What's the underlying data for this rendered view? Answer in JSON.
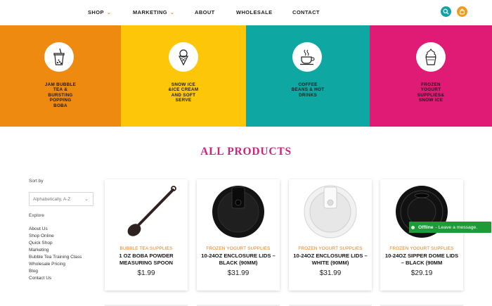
{
  "nav": {
    "shop": "SHOP",
    "marketing": "MARKETING",
    "about": "ABOUT",
    "wholesale": "WHOLESALE",
    "contact": "CONTACT"
  },
  "header_icons": {
    "search": "search-icon",
    "cart": "shopping-bag-icon"
  },
  "colors": {
    "orange": "#ef8a10",
    "yellow": "#fdc608",
    "teal": "#0fa7a1",
    "pink": "#df1b75",
    "title_pink": "#c8267a",
    "chat_green": "#1e9b37"
  },
  "categories": [
    {
      "label": "JAM BUBBLE\nTEA &\nBURSTING\nPOPPING\nBOBA",
      "icon": "bubble-tea-cup-icon"
    },
    {
      "label": "SNOW ICE\n&ICE CREAM\nAND SOFT\nSERVE",
      "icon": "ice-cream-cone-icon"
    },
    {
      "label": "COFFEE\nBEANS & HOT\nDRINKS",
      "icon": "coffee-cup-icon"
    },
    {
      "label": "FROZEN\nYOGURT\nSUPPLIES&\nSNOW ICE",
      "icon": "frozen-yogurt-cup-icon"
    }
  ],
  "page_title": "ALL PRODUCTS",
  "sidebar": {
    "sort_label": "Sort by",
    "sort_value": "Alphabetically, A-Z",
    "explore_label": "Explore",
    "links": [
      "About Us",
      "Shop Online",
      "Quick Shop",
      "Marketing",
      "Bubble Tea Training Class",
      "Wholesale Pricing",
      "Blog",
      "Contact Us"
    ]
  },
  "products": [
    {
      "category": "BUBBLE TEA SUPPLIES",
      "name": "1 OZ BOBA POWDER MEASURING SPOON",
      "price": "$1.99"
    },
    {
      "category": "FROZEN YOGURT SUPPLIES",
      "name": "10-24OZ ENCLOSURE LIDS – BLACK (90MM)",
      "price": "$31.99"
    },
    {
      "category": "FROZEN YOGURT SUPPLIES",
      "name": "10-24OZ ENCLOSURE LIDS – WHITE (90MM)",
      "price": "$31.99"
    },
    {
      "category": "FROZEN YOGURT SUPPLIES",
      "name": "10-24OZ SIPPER DOME LIDS – BLACK (90MM",
      "price": "$29.19"
    }
  ],
  "chat": {
    "status": "Offline",
    "message": "- Leave a message."
  }
}
